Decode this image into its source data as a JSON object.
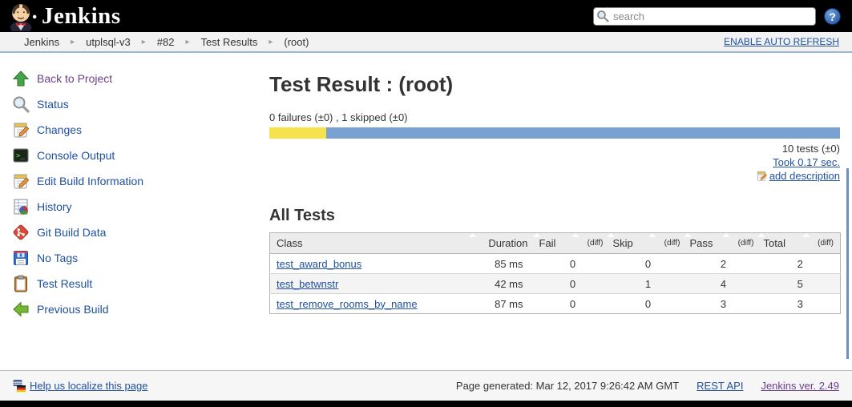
{
  "titlebar": {
    "brand": "Jenkins",
    "search_placeholder": "search",
    "help_glyph": "?"
  },
  "breadcrumb": {
    "items": [
      "Jenkins",
      "utplsql-v3",
      "#82",
      "Test Results",
      "(root)"
    ],
    "auto_refresh_label": "ENABLE AUTO REFRESH"
  },
  "sidebar": {
    "items": [
      {
        "icon": "up-arrow-icon",
        "label": "Back to Project",
        "visited": true
      },
      {
        "icon": "magnifier-icon",
        "label": "Status"
      },
      {
        "icon": "notepad-icon",
        "label": "Changes"
      },
      {
        "icon": "terminal-icon",
        "label": "Console Output"
      },
      {
        "icon": "notepad-icon",
        "label": "Edit Build Information"
      },
      {
        "icon": "history-icon",
        "label": "History"
      },
      {
        "icon": "git-icon",
        "label": "Git Build Data"
      },
      {
        "icon": "floppy-icon",
        "label": "No Tags"
      },
      {
        "icon": "clipboard-icon",
        "label": "Test Result"
      },
      {
        "icon": "left-arrow-icon",
        "label": "Previous Build"
      }
    ]
  },
  "main": {
    "title": "Test Result : (root)",
    "summary": "0 failures (±0) , 1 skipped (±0)",
    "progress": {
      "skipped_percent": 10,
      "passed_percent": 90,
      "skipped_color": "#f5e24d",
      "passed_color": "#79a2d3"
    },
    "tests_total_label": "10 tests (±0)",
    "took_label": "Took 0.17 sec.",
    "add_description_label": "add description",
    "all_tests_heading": "All Tests",
    "table": {
      "columns": [
        "Class",
        "Duration",
        "Fail",
        "(diff)",
        "Skip",
        "(diff)",
        "Pass",
        "(diff)",
        "Total",
        "(diff)"
      ],
      "rows": [
        {
          "class": "test_award_bonus",
          "duration": "85 ms",
          "fail": "0",
          "skip": "0",
          "pass": "2",
          "total": "2"
        },
        {
          "class": "test_betwnstr",
          "duration": "42 ms",
          "fail": "0",
          "skip": "1",
          "pass": "4",
          "total": "5"
        },
        {
          "class": "test_remove_rooms_by_name",
          "duration": "87 ms",
          "fail": "0",
          "skip": "0",
          "pass": "3",
          "total": "3"
        }
      ]
    }
  },
  "footer": {
    "localize_label": "Help us localize this page",
    "generated_label": "Page generated: Mar 12, 2017 9:26:42 AM GMT",
    "rest_api_label": "REST API",
    "version_label": "Jenkins ver. 2.49"
  }
}
